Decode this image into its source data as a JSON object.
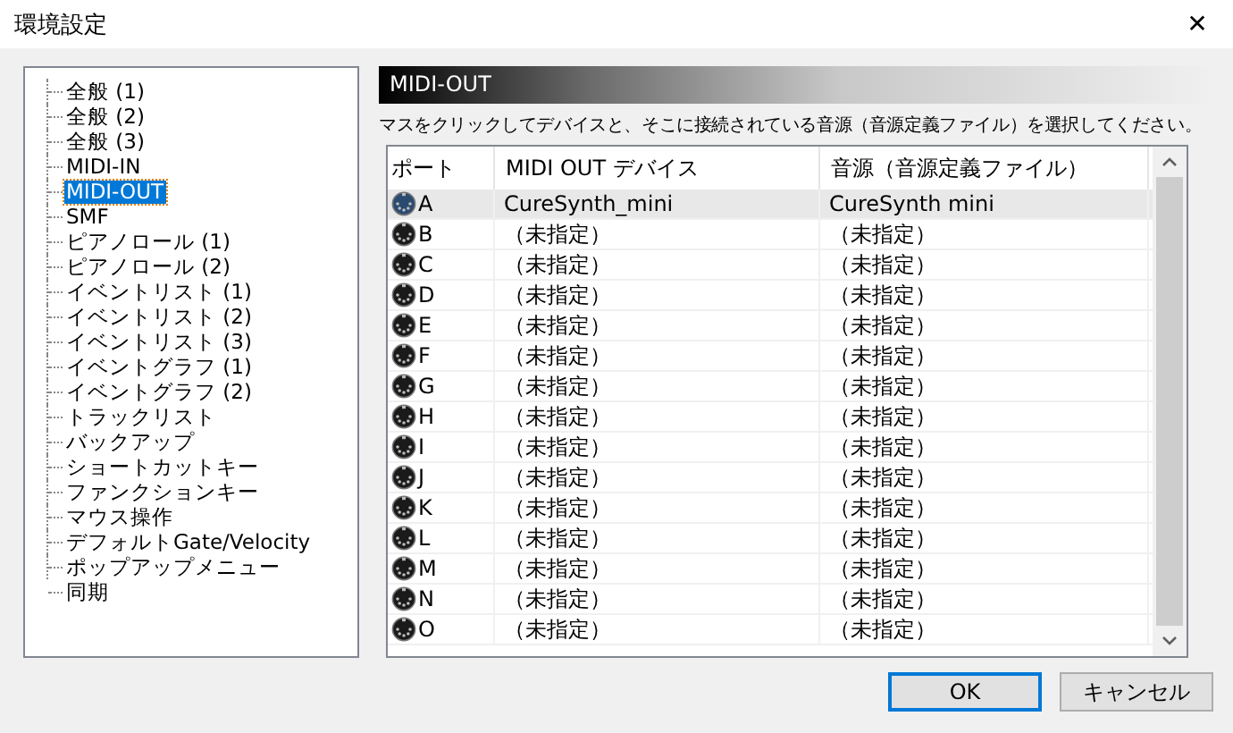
{
  "window": {
    "title": "環境設定",
    "close": "✕"
  },
  "tree": {
    "items": [
      {
        "label": "全般 (1)",
        "selected": false
      },
      {
        "label": "全般 (2)",
        "selected": false
      },
      {
        "label": "全般 (3)",
        "selected": false
      },
      {
        "label": "MIDI-IN",
        "selected": false
      },
      {
        "label": "MIDI-OUT",
        "selected": true
      },
      {
        "label": "SMF",
        "selected": false
      },
      {
        "label": "ピアノロール (1)",
        "selected": false
      },
      {
        "label": "ピアノロール (2)",
        "selected": false
      },
      {
        "label": "イベントリスト (1)",
        "selected": false
      },
      {
        "label": "イベントリスト (2)",
        "selected": false
      },
      {
        "label": "イベントリスト (3)",
        "selected": false
      },
      {
        "label": "イベントグラフ (1)",
        "selected": false
      },
      {
        "label": "イベントグラフ (2)",
        "selected": false
      },
      {
        "label": "トラックリスト",
        "selected": false
      },
      {
        "label": "バックアップ",
        "selected": false
      },
      {
        "label": "ショートカットキー",
        "selected": false
      },
      {
        "label": "ファンクションキー",
        "selected": false
      },
      {
        "label": "マウス操作",
        "selected": false
      },
      {
        "label": "デフォルトGate/Velocity",
        "selected": false
      },
      {
        "label": "ポップアップメニュー",
        "selected": false
      },
      {
        "label": "同期",
        "selected": false
      }
    ]
  },
  "panel": {
    "title": "MIDI-OUT",
    "instruction": "マスをクリックしてデバイスと、そこに接続されている音源（音源定義ファイル）を選択してください。"
  },
  "table": {
    "columns": [
      "ポート",
      "MIDI OUT デバイス",
      "音源（音源定義ファイル）"
    ],
    "rows": [
      {
        "port": "A",
        "device": "CureSynth_mini",
        "source": "CureSynth mini",
        "selected": true
      },
      {
        "port": "B",
        "device": "（未指定）",
        "source": "（未指定）",
        "selected": false
      },
      {
        "port": "C",
        "device": "（未指定）",
        "source": "（未指定）",
        "selected": false
      },
      {
        "port": "D",
        "device": "（未指定）",
        "source": "（未指定）",
        "selected": false
      },
      {
        "port": "E",
        "device": "（未指定）",
        "source": "（未指定）",
        "selected": false
      },
      {
        "port": "F",
        "device": "（未指定）",
        "source": "（未指定）",
        "selected": false
      },
      {
        "port": "G",
        "device": "（未指定）",
        "source": "（未指定）",
        "selected": false
      },
      {
        "port": "H",
        "device": "（未指定）",
        "source": "（未指定）",
        "selected": false
      },
      {
        "port": "I",
        "device": "（未指定）",
        "source": "（未指定）",
        "selected": false
      },
      {
        "port": "J",
        "device": "（未指定）",
        "source": "（未指定）",
        "selected": false
      },
      {
        "port": "K",
        "device": "（未指定）",
        "source": "（未指定）",
        "selected": false
      },
      {
        "port": "L",
        "device": "（未指定）",
        "source": "（未指定）",
        "selected": false
      },
      {
        "port": "M",
        "device": "（未指定）",
        "source": "（未指定）",
        "selected": false
      },
      {
        "port": "N",
        "device": "（未指定）",
        "source": "（未指定）",
        "selected": false
      },
      {
        "port": "O",
        "device": "（未指定）",
        "source": "（未指定）",
        "selected": false
      }
    ]
  },
  "buttons": [
    {
      "label": "OK",
      "default": true
    },
    {
      "label": "キャンセル",
      "default": false
    }
  ]
}
